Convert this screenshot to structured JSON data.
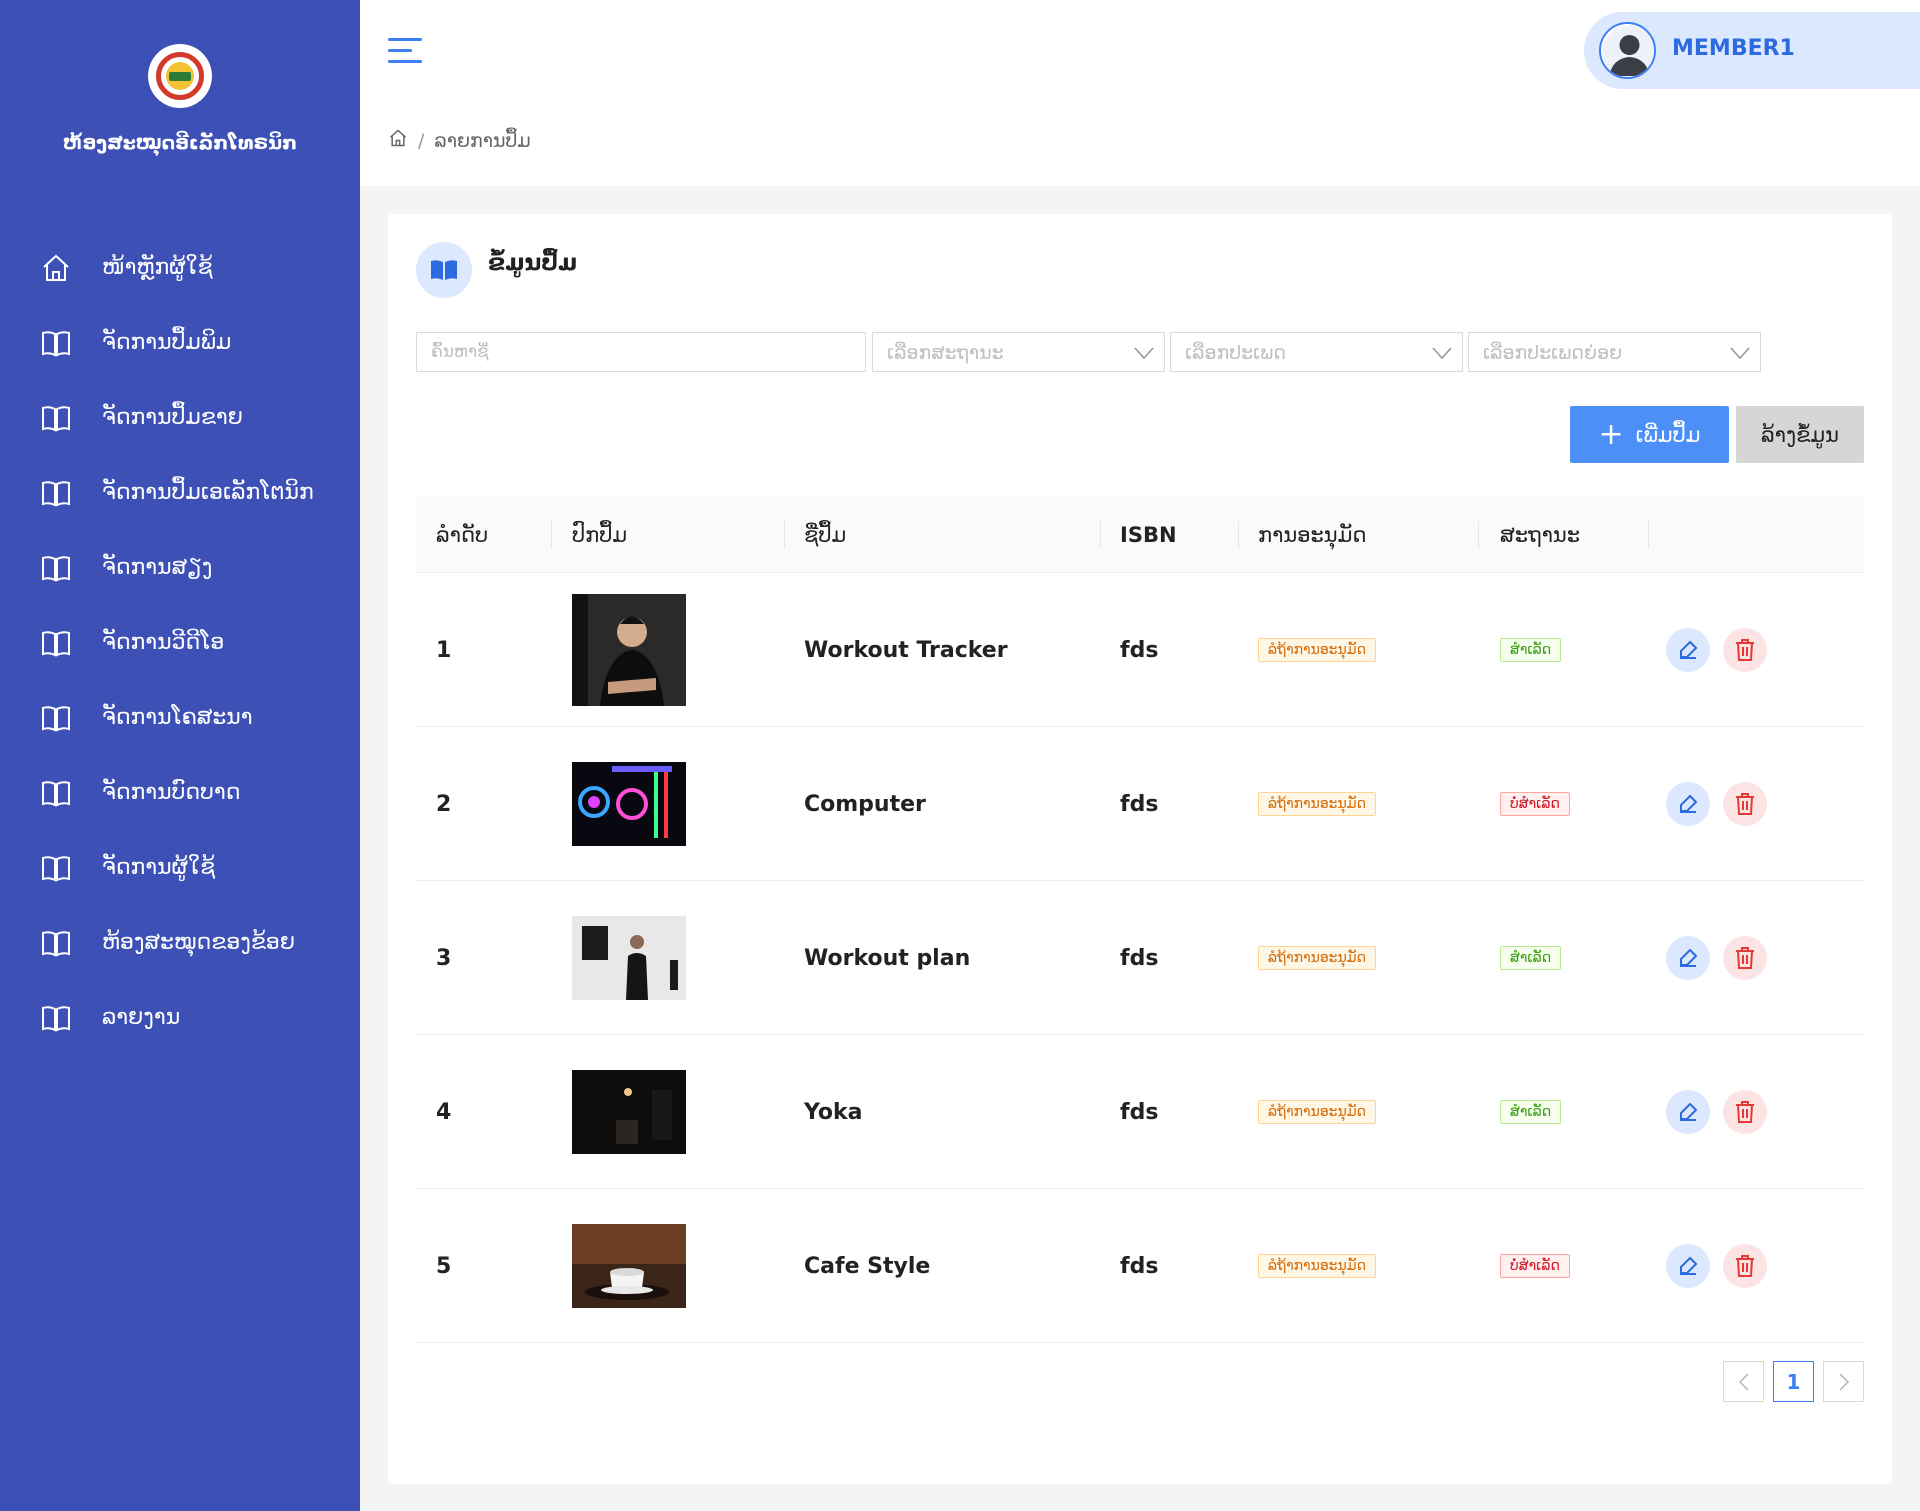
{
  "sidebar": {
    "org_name": "ຫ້ອງສະໝຸດອີເລັກໂທຣນິກ",
    "items": [
      {
        "label": "ໜ້າຫຼັກຜູ້ໃຊ້",
        "icon": "home-icon"
      },
      {
        "label": "ຈັດການປຶ້ມພິມ",
        "icon": "book-icon"
      },
      {
        "label": "ຈັດການປຶ້ມຂາຍ",
        "icon": "book-icon"
      },
      {
        "label": "ຈັດການປຶ້ມເອເລັກໂຕນິກ",
        "icon": "book-icon"
      },
      {
        "label": "ຈັດການສຽງ",
        "icon": "book-icon"
      },
      {
        "label": "ຈັດການວີດີໂອ",
        "icon": "book-icon"
      },
      {
        "label": "ຈັດການໂຄສະນາ",
        "icon": "book-icon"
      },
      {
        "label": "ຈັດການບົດບາດ",
        "icon": "book-icon"
      },
      {
        "label": "ຈັດການຜູ້ໃຊ້",
        "icon": "book-icon"
      },
      {
        "label": "ຫ້ອງສະໝຸດຂອງຂ້ອຍ",
        "icon": "book-icon"
      },
      {
        "label": "ລາຍງານ",
        "icon": "book-icon"
      }
    ]
  },
  "header": {
    "user_name": "MEMBER1",
    "breadcrumb": {
      "current": "ລາຍການປຶ້ມ"
    }
  },
  "card": {
    "title": "ຂໍ້ມູນປຶ້ມ",
    "search_placeholder": "ຄົ້ນຫາຊື່",
    "filters": [
      "ເລືອກສະຖານະ",
      "ເລືອກປະເພດ",
      "ເລືອກປະເພດຍ່ອຍ"
    ],
    "add_button": "ເພີ່ມປຶ້ມ",
    "clear_button": "ລ້າງຂໍ້ມູນ"
  },
  "table": {
    "headers": {
      "index": "ລໍາດັບ",
      "cover": "ປົກປຶ້ມ",
      "name": "ຊື່ປຶ້ມ",
      "isbn": "ISBN",
      "approval": "ການອະນຸມັດ",
      "status": "ສະຖານະ"
    },
    "rows": [
      {
        "index": "1",
        "name": "Workout Tracker",
        "isbn": "fds",
        "approval": "ລໍຖ້າການອະນຸມັດ",
        "status": "ສໍາເລັດ",
        "status_type": "ok",
        "cover": "man-black-shirt"
      },
      {
        "index": "2",
        "name": "Computer",
        "isbn": "fds",
        "approval": "ລໍຖ້າການອະນຸມັດ",
        "status": "ບໍ່ສໍາເລັດ",
        "status_type": "fail",
        "cover": "rgb-pc"
      },
      {
        "index": "3",
        "name": "Workout plan",
        "isbn": "fds",
        "approval": "ລໍຖ້າການອະນຸມັດ",
        "status": "ສໍາເລັດ",
        "status_type": "ok",
        "cover": "man-gallery"
      },
      {
        "index": "4",
        "name": "Yoka",
        "isbn": "fds",
        "approval": "ລໍຖ້າການອະນຸມັດ",
        "status": "ສໍາເລັດ",
        "status_type": "ok",
        "cover": "dark-room"
      },
      {
        "index": "5",
        "name": "Cafe Style",
        "isbn": "fds",
        "approval": "ລໍຖ້າການອະນຸມັດ",
        "status": "ບໍ່ສໍາເລັດ",
        "status_type": "fail",
        "cover": "coffee-cup"
      }
    ]
  },
  "pagination": {
    "current_page": "1"
  },
  "colors": {
    "sidebar": "#3c50b6",
    "primary": "#4c90f7",
    "accent": "#3d7ff5"
  }
}
